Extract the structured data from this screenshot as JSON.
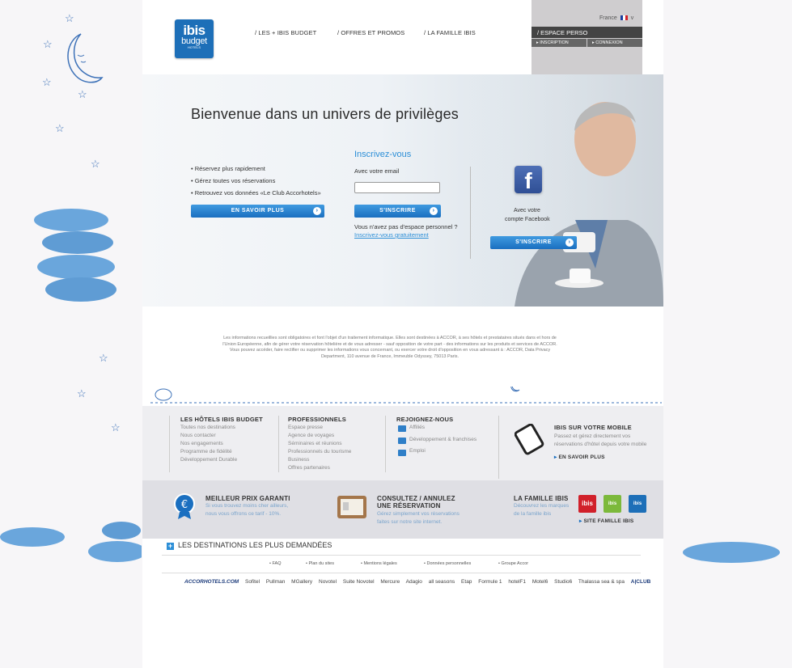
{
  "header": {
    "logo": {
      "line1": "ibis",
      "line2": "budget",
      "line3": "HOTELS"
    },
    "nav": [
      "/ LES + IBIS BUDGET",
      "/ OFFRES ET PROMOS",
      "/ LA FAMILLE IBIS"
    ],
    "language": "France",
    "espace_perso": "/ ESPACE PERSO",
    "inscription": "INSCRIPTION",
    "connexion": "CONNEXION"
  },
  "hero": {
    "title": "Bienvenue dans un univers de privilèges",
    "bullets": [
      "Réservez plus rapidement",
      "Gérez toutes vos réservations",
      "Retrouvez vos données «Le Club Accorhotels»"
    ],
    "en_savoir_plus": "EN SAVOIR PLUS",
    "signup_title": "Inscrivez-vous",
    "email_label": "Avec votre email",
    "email_value": "",
    "sinscrire": "S'INSCRIRE",
    "no_account": "Vous n'avez pas d'espace personnel ?",
    "signup_free": "Inscrivez-vous gratuitement",
    "fb_line1": "Avec votre",
    "fb_line2": "compte Facebook",
    "fb_sinscrire": "S'INSCRIRE"
  },
  "legal": {
    "p1": "Les informations recueillies sont obligatoires et font l'objet d'un traitement informatique. Elles sont destinées à ACCOR, à ses hôtels et prestataires situés dans et hors de l'Union Européenne, afin de gérer votre réservation hôtelière et de vous adresser - sauf opposition de votre part - des informations sur les produits et services de ACCOR.",
    "p2": "Vous pouvez accéder, faire rectifier ou supprimer les informations vous concernant, ou exercer votre droit d'opposition en vous adressant à : ACCOR, Data Privacy Department, 110 avenue de France, Immeuble Odyssey, 75013 Paris."
  },
  "footer": {
    "col1": {
      "title": "LES HÔTELS IBIS BUDGET",
      "items": [
        "Toutes nos destinations",
        "Nous contacter",
        "Nos engagements",
        "Programme de fidélité",
        "Développement Durable"
      ]
    },
    "col2": {
      "title": "PROFESSIONNELS",
      "items": [
        "Espace presse",
        "Agence de voyages",
        "Séminaires et réunions",
        "Professionnels du tourisme",
        "Business",
        "Offres partenaires"
      ]
    },
    "col3": {
      "title": "REJOIGNEZ-NOUS",
      "items": [
        "Affiliés",
        "Développement & franchises",
        "Emploi"
      ]
    },
    "mobile": {
      "title": "IBIS SUR VOTRE MOBILE",
      "text1": "Passez et gérez directement vos",
      "text2": "réservations d'hôtel depuis votre mobile",
      "link": "EN SAVOIR PLUS"
    },
    "best_price": {
      "title": "MEILLEUR PRIX GARANTI",
      "text1": "Si vous trouvez moins cher ailleurs,",
      "text2": "nous vous offrons ce tarif - 10%."
    },
    "consult": {
      "title1": "CONSULTEZ / ANNULEZ",
      "title2": "UNE RÉSERVATION",
      "text1": "Gérez simplement vos réservations",
      "text2": "faites sur notre site internet."
    },
    "famille": {
      "title": "LA FAMILLE IBIS",
      "text1": "Découvrez les marques",
      "text2": "de la famille ibis",
      "link": "SITE FAMILLE IBIS"
    },
    "destinations": "LES DESTINATIONS LES PLUS DEMANDÉES",
    "links": [
      "FAQ",
      "Plan du sites",
      "Mentions légales",
      "Données personnelles",
      "Groupe Accor"
    ],
    "brands": [
      "ACCORHOTELS.COM",
      "Sofitel",
      "Pullman",
      "MGallery",
      "Novotel",
      "Suite Novotel",
      "Mercure",
      "Adagio",
      "all seasons",
      "Etap",
      "Formule 1",
      "hotelF1",
      "Motel6",
      "Studio6",
      "Thalassa sea & spa",
      "A|CLUB"
    ]
  }
}
